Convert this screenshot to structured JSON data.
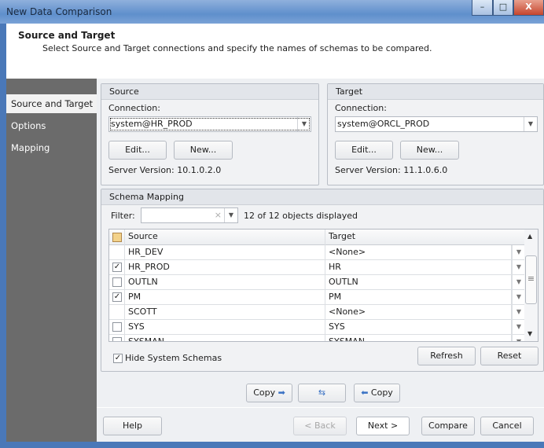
{
  "window": {
    "title": "New Data Comparison",
    "minimize": "–",
    "restore": "□",
    "close": "X"
  },
  "header": {
    "title": "Source and Target",
    "description": "Select Source and Target connections and specify the names of schemas to be compared."
  },
  "sidebar": {
    "items": [
      {
        "label": "Source and Target",
        "selected": true
      },
      {
        "label": "Options"
      },
      {
        "label": "Mapping"
      }
    ]
  },
  "source": {
    "title": "Source",
    "connection_label": "Connection:",
    "connection": "system@HR_PROD",
    "edit": "Edit...",
    "new": "New...",
    "server_version": "Server Version: 10.1.0.2.0"
  },
  "target": {
    "title": "Target",
    "connection_label": "Connection:",
    "connection": "system@ORCL_PROD",
    "edit": "Edit...",
    "new": "New...",
    "server_version": "Server Version: 11.1.0.6.0"
  },
  "mapping": {
    "title": "Schema Mapping",
    "filter_label": "Filter:",
    "filter_value": "",
    "count": "12 of 12 objects displayed",
    "columns": [
      "Source",
      "Target"
    ],
    "rows": [
      {
        "checkbox": "none",
        "source": "HR_DEV",
        "target": "<None>"
      },
      {
        "checkbox": "checked",
        "source": "HR_PROD",
        "target": "HR"
      },
      {
        "checkbox": "unchecked",
        "source": "OUTLN",
        "target": "OUTLN"
      },
      {
        "checkbox": "checked",
        "source": "PM",
        "target": "PM"
      },
      {
        "checkbox": "none",
        "source": "SCOTT",
        "target": "<None>"
      },
      {
        "checkbox": "unchecked",
        "source": "SYS",
        "target": "SYS"
      },
      {
        "checkbox": "unchecked",
        "source": "SYSMAN",
        "target": "SYSMAN"
      }
    ],
    "hide_system": "Hide System Schemas",
    "refresh": "Refresh",
    "reset": "Reset"
  },
  "copy": {
    "copy_right": "Copy",
    "copy_left": "Copy"
  },
  "footer": {
    "help": "Help",
    "back": "< Back",
    "next": "Next >",
    "compare": "Compare",
    "cancel": "Cancel"
  }
}
